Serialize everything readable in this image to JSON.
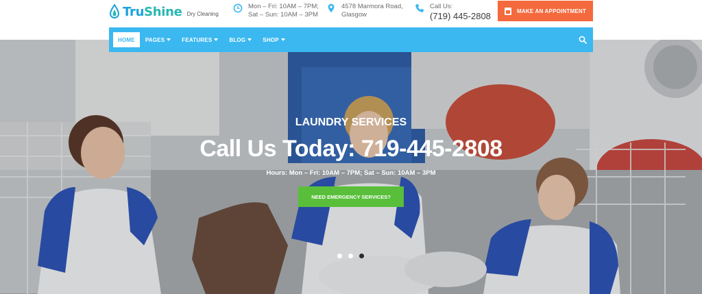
{
  "brand": {
    "name_part1": "Tru",
    "name_part2": "Shine",
    "tagline": "Dry Cleaning"
  },
  "header_info": {
    "hours_line1": "Mon – Fri: 10AM – 7PM;",
    "hours_line2": "Sat – Sun: 10AM – 3PM",
    "address_line1": "4578 Marmora Road,",
    "address_line2": "Glasgow",
    "call_label": "Call Us:",
    "call_number": "(719) 445-2808"
  },
  "appointment_button": {
    "label": "MAKE AN APPOINTMENT"
  },
  "nav": {
    "items": [
      {
        "label": "HOME",
        "active": true
      },
      {
        "label": "PAGES",
        "dropdown": true
      },
      {
        "label": "FEATURES",
        "dropdown": true
      },
      {
        "label": "BLOG",
        "dropdown": true
      },
      {
        "label": "SHOP",
        "dropdown": true
      }
    ]
  },
  "hero": {
    "subtitle": "LAUNDRY SERVICES",
    "title": "Call Us Today: 719-445-2808",
    "hours": "Hours: Mon – Fri: 10AM – 7PM; Sat – Sun: 10AM – 3PM",
    "cta_label": "NEED EMERGENCY SERVICES?"
  },
  "slider": {
    "count": 3,
    "active_index": 2
  },
  "colors": {
    "brand_blue": "#1aa3dc",
    "brand_teal": "#28b8b0",
    "nav_blue": "#3bb8f0",
    "appointment_orange": "#f4693d",
    "cta_green": "#59bf3b"
  },
  "icons": {
    "clock": "clock-icon",
    "location": "map-pin-icon",
    "phone": "phone-icon",
    "calendar": "calendar-icon",
    "search": "search-icon",
    "logo": "water-drop-icon"
  }
}
